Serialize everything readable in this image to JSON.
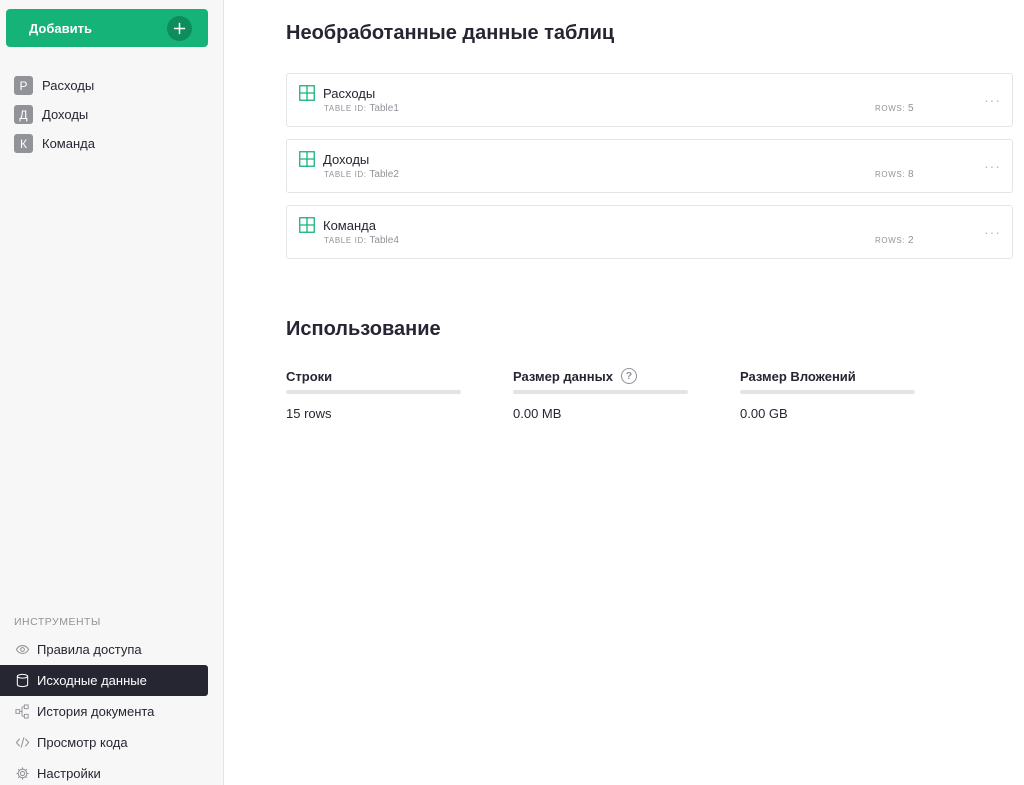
{
  "sidebar": {
    "add_label": "Добавить",
    "pages": [
      {
        "initial": "Р",
        "label": "Расходы"
      },
      {
        "initial": "Д",
        "label": "Доходы"
      },
      {
        "initial": "К",
        "label": "Команда"
      }
    ],
    "tools_header": "ИНСТРУМЕНТЫ",
    "tools": [
      {
        "label": "Правила доступа",
        "icon": "eye-icon"
      },
      {
        "label": "Исходные данные",
        "icon": "database-icon",
        "active": true
      },
      {
        "label": "История документа",
        "icon": "history-icon"
      },
      {
        "label": "Просмотр кода",
        "icon": "code-icon"
      },
      {
        "label": "Настройки",
        "icon": "gear-icon"
      }
    ]
  },
  "main": {
    "title": "Необработанные данные таблиц",
    "tables": [
      {
        "name": "Расходы",
        "id_label": "TABLE ID: ",
        "id": "Table1",
        "rows_label": "ROWS: ",
        "rows": "5"
      },
      {
        "name": "Доходы",
        "id_label": "TABLE ID: ",
        "id": "Table2",
        "rows_label": "ROWS: ",
        "rows": "8"
      },
      {
        "name": "Команда",
        "id_label": "TABLE ID: ",
        "id": "Table4",
        "rows_label": "ROWS: ",
        "rows": "2"
      }
    ],
    "more_label": "···",
    "usage_title": "Использование",
    "metrics": [
      {
        "label": "Строки",
        "value": "15 rows",
        "fill": 0
      },
      {
        "label": "Размер данных",
        "value": "0.00 MB",
        "help": "?",
        "fill": 0
      },
      {
        "label": "Размер Вложений",
        "value": "0.00 GB",
        "fill": 0
      }
    ]
  },
  "colors": {
    "accent": "#16b378",
    "accent_dark": "#0d8c5c",
    "active_bg": "#262633"
  }
}
